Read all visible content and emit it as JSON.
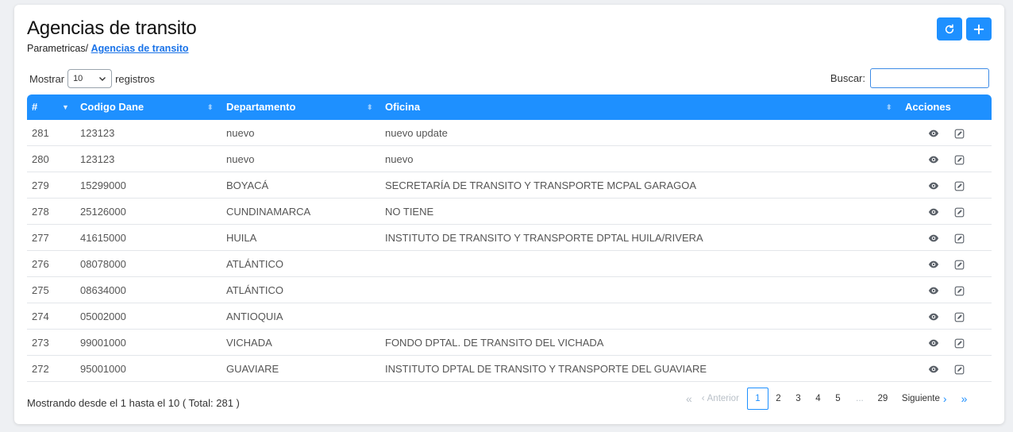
{
  "page": {
    "title": "Agencias de transito",
    "breadcrumb_parent": "Parametricas/",
    "breadcrumb_current": "Agencias de transito"
  },
  "controls": {
    "show_label": "Mostrar",
    "page_size": "10",
    "records_label": "registros",
    "search_label": "Buscar:",
    "search_value": ""
  },
  "table": {
    "columns": [
      "#",
      "Codigo Dane",
      "Departamento",
      "Oficina",
      "Acciones"
    ],
    "rows": [
      {
        "id": "281",
        "codigo": "123123",
        "departamento": "nuevo",
        "oficina": "nuevo update"
      },
      {
        "id": "280",
        "codigo": "123123",
        "departamento": "nuevo",
        "oficina": "nuevo"
      },
      {
        "id": "279",
        "codigo": "15299000",
        "departamento": "BOYACÁ",
        "oficina": "SECRETARÍA DE TRANSITO Y TRANSPORTE MCPAL GARAGOA"
      },
      {
        "id": "278",
        "codigo": "25126000",
        "departamento": "CUNDINAMARCA",
        "oficina": "NO TIENE"
      },
      {
        "id": "277",
        "codigo": "41615000",
        "departamento": "HUILA",
        "oficina": "INSTITUTO DE TRANSITO Y TRANSPORTE DPTAL HUILA/RIVERA"
      },
      {
        "id": "276",
        "codigo": "08078000",
        "departamento": "ATLÁNTICO",
        "oficina": ""
      },
      {
        "id": "275",
        "codigo": "08634000",
        "departamento": "ATLÁNTICO",
        "oficina": ""
      },
      {
        "id": "274",
        "codigo": "05002000",
        "departamento": "ANTIOQUIA",
        "oficina": ""
      },
      {
        "id": "273",
        "codigo": "99001000",
        "departamento": "VICHADA",
        "oficina": "FONDO DPTAL. DE TRANSITO DEL VICHADA"
      },
      {
        "id": "272",
        "codigo": "95001000",
        "departamento": "GUAVIARE",
        "oficina": "INSTITUTO DPTAL DE TRANSITO Y TRANSPORTE DEL  GUAVIARE"
      }
    ]
  },
  "footer": {
    "info": "Mostrando desde el 1 hasta el 10 ( Total: 281 )"
  },
  "pagination": {
    "first": "«",
    "prev": "Anterior",
    "pages": [
      "1",
      "2",
      "3",
      "4",
      "5",
      "...",
      "29"
    ],
    "next": "Siguiente",
    "last": "»",
    "active_page": "1"
  },
  "colors": {
    "accent": "#1e90ff",
    "link": "#1a73e8"
  },
  "icons": {
    "refresh": "refresh-icon",
    "add": "plus-icon",
    "view": "eye-icon",
    "edit": "edit-icon"
  }
}
